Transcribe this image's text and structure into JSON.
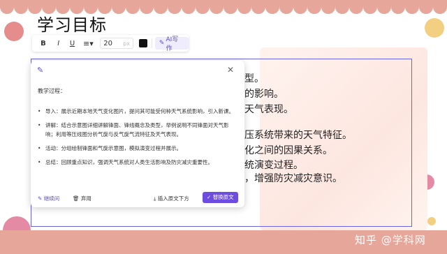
{
  "colors": {
    "accent": "#6c4ddf",
    "frame": "#6a66d8",
    "deco_pink": "#e7a69a",
    "deco_yellow": "#f3cf82",
    "deco_magenta": "#e58aa5"
  },
  "slide": {
    "title": "学习目标",
    "background_lines": [
      "型。",
      "的影响。",
      "天气表现。",
      "压系统带来的天气特征。",
      "化之间的因果关系。",
      "统演变过程。",
      "，增强防灾减灾意识。"
    ]
  },
  "toolbar": {
    "bold_label": "B",
    "italic_label": "I",
    "underline_label": "U",
    "align_icon": "align-left-icon",
    "font_size": "20",
    "font_unit": "px",
    "text_color": "#111111",
    "ai_label": "AI写作"
  },
  "ai_panel": {
    "icon": "magic-wand-icon",
    "heading": "教学过程：",
    "items": [
      "导入：展示近期本地天气变化图片，提问其可能受何种天气系统影响，引入新课。",
      "讲解：结合示意图详细讲解锋面、锋线概念及类型，举例说明不同锋面对天气影响；利用等压线图分析气旋与反气旋气流特征及天气表现。",
      "活动：分组绘制锋面和气旋示意图，模拟演变过程并展示。",
      "总结：回顾重点知识，强调天气系统对人类生活影响及防灾减灾重要性。"
    ],
    "footer": {
      "continue_label": "继续问",
      "discard_label": "弃用",
      "insert_label": "插入原文下方",
      "replace_label": "替换原文"
    }
  },
  "watermark": "知乎 @学科网"
}
